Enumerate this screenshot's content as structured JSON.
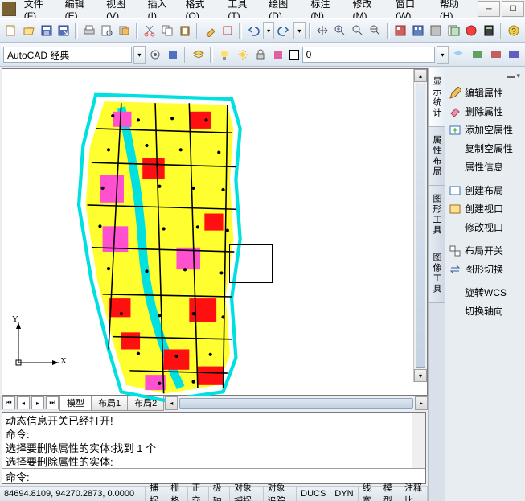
{
  "menu": {
    "items": [
      "文件(F)",
      "编辑(E)",
      "视图(V)",
      "插入(I)",
      "格式(O)",
      "工具(T)",
      "绘图(D)",
      "标注(N)",
      "修改(M)",
      "窗口(W)",
      "帮助(H)"
    ]
  },
  "workspace": {
    "selector": "AutoCAD 经典"
  },
  "layerbox": {
    "value": "0"
  },
  "tabs": {
    "model": "模型",
    "layout1": "布局1",
    "layout2": "布局2"
  },
  "cmd": {
    "line1": "动态信息开关已经打开!",
    "line2": "命令:",
    "line3": "选择要删除属性的实体:找到 1 个",
    "line4": "选择要删除属性的实体:",
    "prompt": "命令:"
  },
  "status": {
    "coords": "84694.8109, 94270.2873, 0.0000",
    "b1": "捕捉",
    "b2": "栅格",
    "b3": "正交",
    "b4": "极轴",
    "b5": "对象捕捉",
    "b6": "对象追踪",
    "b7": "DUCS",
    "b8": "DYN",
    "b9": "线宽",
    "b10": "模型",
    "b11": "注释比"
  },
  "rp": {
    "tab1": "显示统计",
    "tab2": "属性布局",
    "tab3": "图形工具",
    "tab4": "图像工具",
    "i1": "编辑属性",
    "i2": "删除属性",
    "i3": "添加空属性",
    "i4": "复制空属性",
    "i5": "属性信息",
    "i6": "创建布局",
    "i7": "创建视口",
    "i8": "修改视口",
    "i9": "布局开关",
    "i10": "图形切换",
    "i11": "旋转WCS",
    "i12": "切换轴向"
  },
  "ucs": {
    "x": "X",
    "y": "Y"
  }
}
